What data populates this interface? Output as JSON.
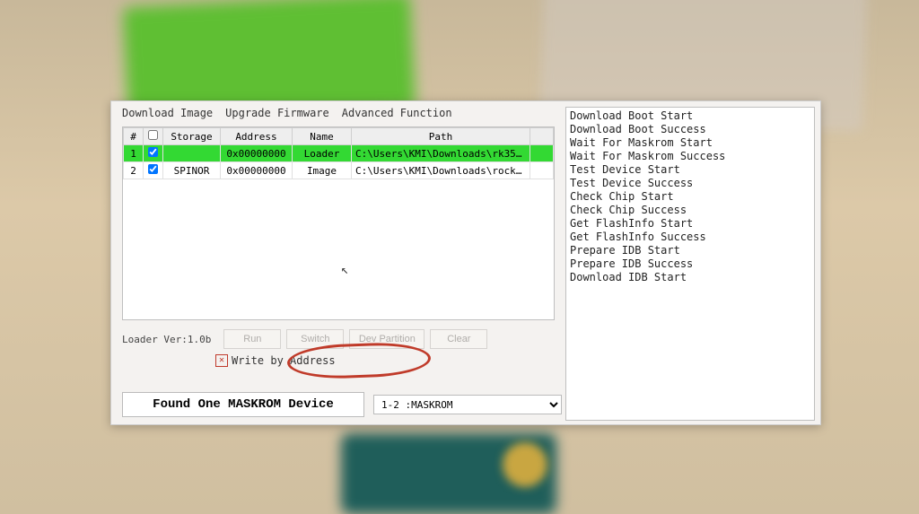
{
  "tabs": {
    "download_image": "Download Image",
    "upgrade_firmware": "Upgrade Firmware",
    "advanced_function": "Advanced Function"
  },
  "table": {
    "headers": {
      "num": "#",
      "storage": "Storage",
      "address": "Address",
      "name": "Name",
      "path": "Path"
    },
    "rows": [
      {
        "num": "1",
        "checked": true,
        "storage": "",
        "address": "0x00000000",
        "name": "Loader",
        "path": "C:\\Users\\KMI\\Downloads\\rk3588_s..."
      },
      {
        "num": "2",
        "checked": true,
        "storage": "SPINOR",
        "address": "0x00000000",
        "name": "Image",
        "path": "C:\\Users\\KMI\\Downloads\\rock-5b-..."
      }
    ]
  },
  "loader_ver_label": "Loader Ver:1.0b",
  "buttons": {
    "run": "Run",
    "switch": "Switch",
    "dev_partition": "Dev Partition",
    "clear": "Clear"
  },
  "write_by_address_label": "Write by Address",
  "status_text": "Found One MASKROM Device",
  "device_dropdown_value": "1-2 :MASKROM",
  "log_lines": [
    "Download Boot Start",
    "Download Boot Success",
    "Wait For Maskrom Start",
    "Wait For Maskrom Success",
    "Test Device Start",
    "Test Device Success",
    "Check Chip Start",
    " Check Chip Success",
    "Get FlashInfo Start",
    "Get FlashInfo Success",
    "Prepare IDB Start",
    "Prepare IDB Success",
    "Download IDB Start"
  ]
}
